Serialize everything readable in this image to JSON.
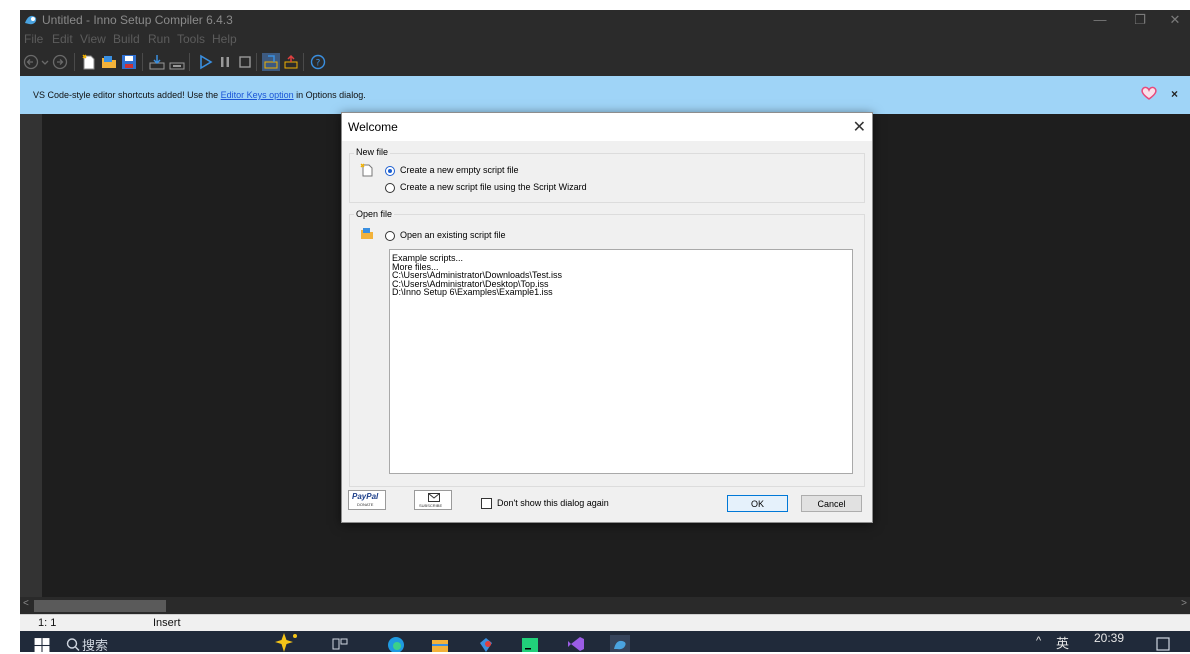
{
  "window": {
    "title": "Untitled - Inno Setup Compiler 6.4.3",
    "controls": {
      "minimize": "—",
      "maximize": "❐",
      "close": "✕"
    }
  },
  "menu": [
    "File",
    "Edit",
    "View",
    "Build",
    "Run",
    "Tools",
    "Help"
  ],
  "infobar": {
    "message_prefix": "VS Code-style editor shortcuts added! Use the ",
    "link": "Editor Keys option",
    "message_suffix": " in Options dialog.",
    "close": "×"
  },
  "statusbar": {
    "position": "1:  1",
    "mode": "Insert"
  },
  "dialog": {
    "title": "Welcome",
    "close": "✕",
    "new_file": {
      "label": "New file",
      "options": [
        "Create a new empty script file",
        "Create a new script file using the Script Wizard"
      ],
      "selected": 0
    },
    "open_file": {
      "label": "Open file",
      "option": "Open an existing script file",
      "files": [
        "Example scripts...",
        "More files...",
        "C:\\Users\\Administrator\\Downloads\\Test.iss",
        "C:\\Users\\Administrator\\Desktop\\Top.iss",
        "D:\\Inno Setup 6\\Examples\\Example1.iss"
      ]
    },
    "paypal": {
      "brand": "PayPal",
      "caption": "DONATE"
    },
    "subscribe": {
      "caption": "SUBSCRIBE"
    },
    "dont_show": "Don't show this dialog again",
    "ok": "OK",
    "cancel": "Cancel"
  },
  "taskbar": {
    "search": "搜索",
    "tray_chevron": "^",
    "ime": "英",
    "clock": "20:39"
  },
  "colors": {
    "infobar": "#9fd4f7",
    "editor_bg": "#1e1e1e",
    "titlebar_bg": "#2b2b2b",
    "accent": "#1d5fd1",
    "taskbar_bg": "#202a3a"
  }
}
